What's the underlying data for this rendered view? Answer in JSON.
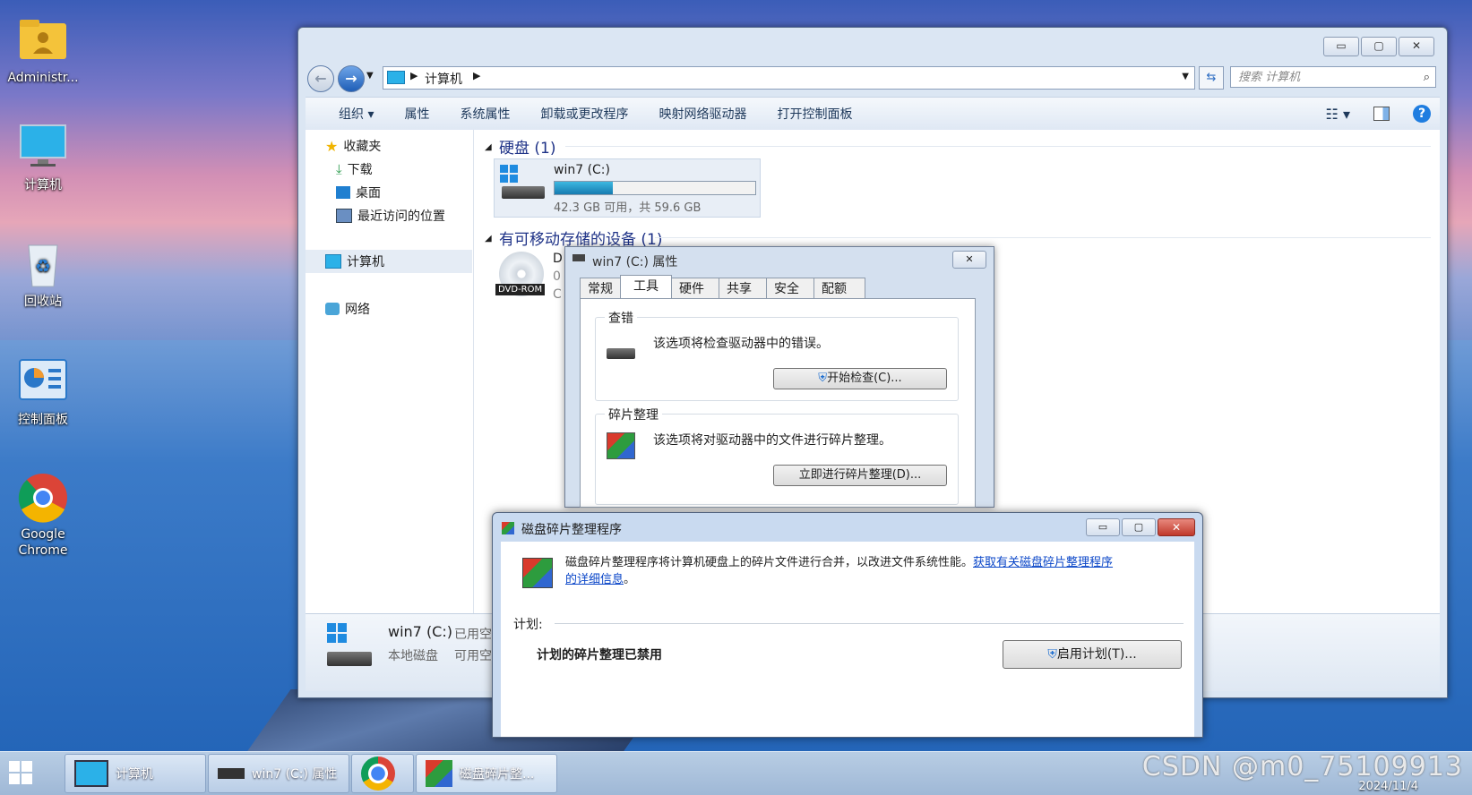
{
  "desktop": {
    "icons": [
      {
        "label": "Administr...",
        "icon": "user-folder-icon"
      },
      {
        "label": "计算机",
        "icon": "computer-icon"
      },
      {
        "label": "回收站",
        "icon": "recycle-bin-icon"
      },
      {
        "label": "控制面板",
        "icon": "control-panel-icon"
      },
      {
        "label": "Google\nChrome",
        "line1": "Google",
        "line2": "Chrome",
        "icon": "chrome-icon"
      }
    ]
  },
  "explorer": {
    "caption_buttons": [
      "▭",
      "▢",
      "✕"
    ],
    "breadcrumb": "计算机",
    "search_placeholder": "搜索 计算机",
    "toolbar": [
      "组织 ▾",
      "属性",
      "系统属性",
      "卸载或更改程序",
      "映射网络驱动器",
      "打开控制面板"
    ],
    "nav": {
      "favorites": "收藏夹",
      "downloads": "下载",
      "desktop": "桌面",
      "recent": "最近访问的位置",
      "computer": "计算机",
      "network": "网络"
    },
    "hard_disks_header": "硬盘 (1)",
    "drive": {
      "name": "win7 (C:)",
      "free_text": "42.3 GB 可用，共 59.6 GB",
      "used_fraction": 0.29
    },
    "removable_header": "有可移动存储的设备 (1)",
    "dvd_label": "DVD-ROM",
    "dvd_partial": [
      "D",
      "0",
      "C"
    ],
    "details": {
      "name": "win7 (C:)",
      "used_label": "已用空",
      "type": "本地磁盘",
      "free_label": "可用空"
    }
  },
  "props_dialog": {
    "title": "win7 (C:) 属性",
    "close": "✕",
    "tabs": [
      "常规",
      "工具",
      "硬件",
      "共享",
      "安全",
      "配额"
    ],
    "active_tab": "工具",
    "check_group_title": "查错",
    "check_text": "该选项将检查驱动器中的错误。",
    "check_button": "开始检查(C)...",
    "defrag_group_title": "碎片整理",
    "defrag_text": "该选项将对驱动器中的文件进行碎片整理。",
    "defrag_button": "立即进行碎片整理(D)..."
  },
  "defrag_window": {
    "title": "磁盘碎片整理程序",
    "caption_buttons": [
      "▭",
      "▢",
      "✕"
    ],
    "intro": "磁盘碎片整理程序将计算机硬盘上的碎片文件进行合并，以改进文件系统性能。",
    "link_part1": "获取有关磁盘碎片整理程序",
    "link_part2": "的详细信息",
    "period": "。",
    "schedule_label": "计划:",
    "schedule_status": "计划的碎片整理已禁用",
    "enable_button": "启用计划(T)..."
  },
  "taskbar": {
    "items": [
      "计算机",
      "win7 (C:) 属性",
      "磁盘碎片整..."
    ],
    "watermark": "CSDN @m0_75109913",
    "date": "2024/11/4"
  }
}
